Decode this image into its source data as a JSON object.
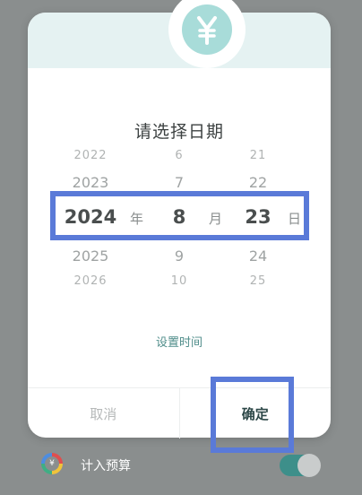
{
  "dialog": {
    "title": "请选择日期",
    "logo_glyph": "¥",
    "set_time_label": "设置时间",
    "cancel_label": "取消",
    "confirm_label": "确定"
  },
  "picker": {
    "years": [
      "2022",
      "2023",
      "2024",
      "2025",
      "2026"
    ],
    "months": [
      "6",
      "7",
      "8",
      "9",
      "10"
    ],
    "days": [
      "21",
      "22",
      "23",
      "24",
      "25"
    ],
    "year_unit": "年",
    "month_unit": "月",
    "day_unit": "日",
    "selected": {
      "year": "2024",
      "month": "8",
      "day": "23"
    }
  },
  "budget": {
    "label": "计入预算",
    "icon_glyph": "¥",
    "toggle_on": true
  },
  "colors": {
    "accent": "#3d8f8a",
    "highlight_outline": "#5a7ad8"
  }
}
